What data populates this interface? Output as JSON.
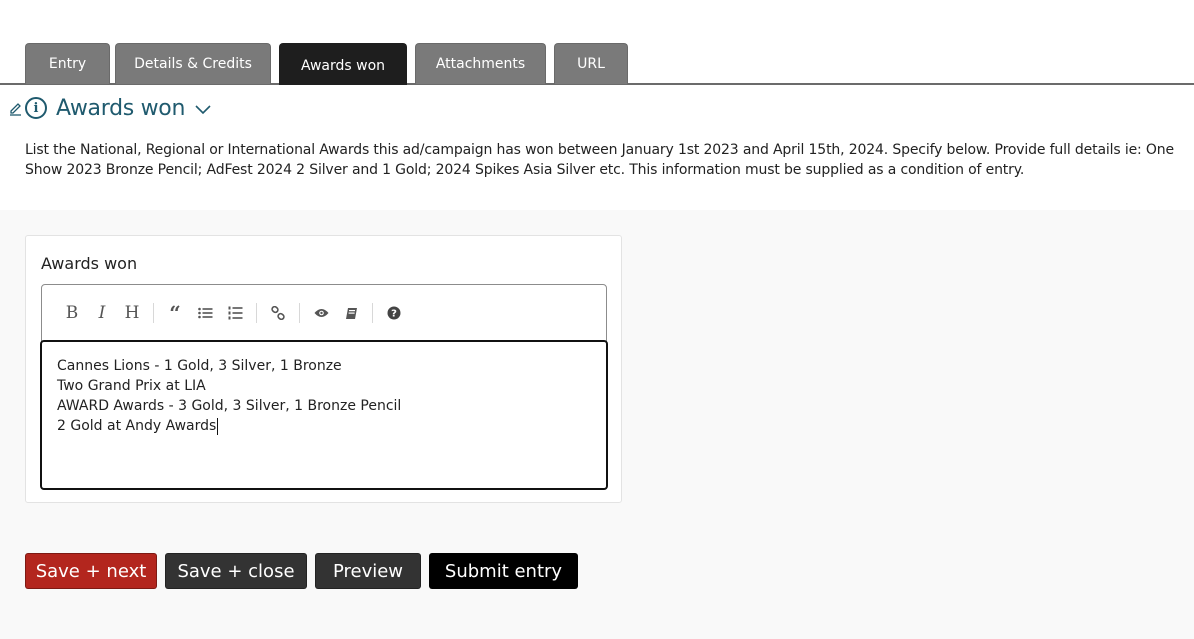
{
  "tabs": [
    {
      "label": "Entry",
      "active": false
    },
    {
      "label": "Details & Credits",
      "active": false
    },
    {
      "label": "Awards won",
      "active": true
    },
    {
      "label": "Attachments",
      "active": false
    },
    {
      "label": "URL",
      "active": false
    }
  ],
  "section": {
    "title": "Awards won",
    "icons": [
      "pencil-icon",
      "info-icon",
      "chevron-down-icon"
    ],
    "description": "List the National, Regional or International Awards this ad/campaign has won between January 1st 2023 and April 15th, 2024. Specify below. Provide full details ie: One Show 2023 Bronze Pencil; AdFest 2024 2 Silver and 1 Gold; 2024 Spikes Asia Silver etc. This information must be supplied as a condition of entry."
  },
  "field": {
    "label": "Awards won",
    "toolbar": [
      "bold",
      "italic",
      "heading",
      "quote",
      "unordered-list",
      "ordered-list",
      "link",
      "preview",
      "guide",
      "help"
    ],
    "lines": [
      "Cannes Lions - 1 Gold, 3 Silver, 1 Bronze",
      "Two Grand Prix at LIA",
      "AWARD Awards - 3 Gold, 3 Silver, 1 Bronze Pencil",
      "2 Gold at Andy Awards"
    ]
  },
  "buttons": {
    "save_next": "Save + next",
    "save_close": "Save + close",
    "preview": "Preview",
    "submit": "Submit entry"
  },
  "colors": {
    "accent_red": "#b3261e",
    "dark_button": "#333333",
    "submit_button": "#000000",
    "title_teal": "#1f5a6e",
    "tab_inactive": "#7a7a7a",
    "tab_active": "#1e1e1e"
  }
}
